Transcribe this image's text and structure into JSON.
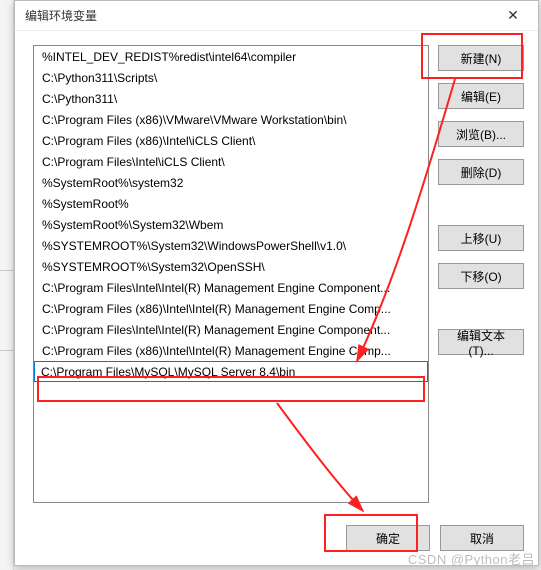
{
  "dialog": {
    "title": "编辑环境变量",
    "close_glyph": "✕"
  },
  "list": {
    "items": [
      "%INTEL_DEV_REDIST%redist\\intel64\\compiler",
      "C:\\Python311\\Scripts\\",
      "C:\\Python311\\",
      "C:\\Program Files (x86)\\VMware\\VMware Workstation\\bin\\",
      "C:\\Program Files (x86)\\Intel\\iCLS Client\\",
      "C:\\Program Files\\Intel\\iCLS Client\\",
      "%SystemRoot%\\system32",
      "%SystemRoot%",
      "%SystemRoot%\\System32\\Wbem",
      "%SYSTEMROOT%\\System32\\WindowsPowerShell\\v1.0\\",
      "%SYSTEMROOT%\\System32\\OpenSSH\\",
      "C:\\Program Files\\Intel\\Intel(R) Management Engine Component...",
      "C:\\Program Files (x86)\\Intel\\Intel(R) Management Engine Comp...",
      "C:\\Program Files\\Intel\\Intel(R) Management Engine Component...",
      "C:\\Program Files (x86)\\Intel\\Intel(R) Management Engine Comp..."
    ],
    "editing_value": "C:\\Program Files\\MySQL\\MySQL Server 8.4\\bin"
  },
  "buttons": {
    "new": "新建(N)",
    "edit": "编辑(E)",
    "browse": "浏览(B)...",
    "delete": "删除(D)",
    "move_up": "上移(U)",
    "move_down": "下移(O)",
    "edit_text": "编辑文本(T)...",
    "ok": "确定",
    "cancel": "取消"
  },
  "watermark": "CSDN @Python老吕"
}
